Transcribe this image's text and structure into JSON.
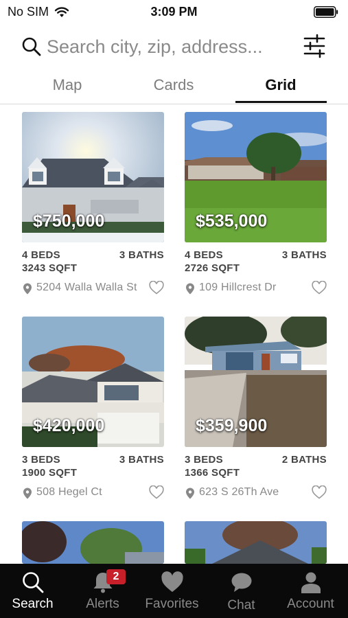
{
  "status_bar": {
    "carrier": "No SIM",
    "time": "3:09 PM"
  },
  "search": {
    "placeholder": "Search city, zip, address..."
  },
  "view_tabs": [
    {
      "label": "Map",
      "active": false
    },
    {
      "label": "Cards",
      "active": false
    },
    {
      "label": "Grid",
      "active": true
    }
  ],
  "listings": [
    {
      "price": "$750,000",
      "beds": "4 BEDS",
      "baths": "3 BATHS",
      "sqft": "3243 SQFT",
      "address": "5204 Walla Walla St"
    },
    {
      "price": "$535,000",
      "beds": "4 BEDS",
      "baths": "3 BATHS",
      "sqft": "2726 SQFT",
      "address": "109 Hillcrest Dr"
    },
    {
      "price": "$420,000",
      "beds": "3 BEDS",
      "baths": "3 BATHS",
      "sqft": "1900 SQFT",
      "address": "508 Hegel Ct"
    },
    {
      "price": "$359,900",
      "beds": "3 BEDS",
      "baths": "2 BATHS",
      "sqft": "1366 SQFT",
      "address": "623 S 26Th Ave"
    }
  ],
  "bottom_nav": [
    {
      "label": "Search",
      "icon": "search-icon",
      "active": true
    },
    {
      "label": "Alerts",
      "icon": "bell-icon",
      "badge": "2",
      "active": false
    },
    {
      "label": "Favorites",
      "icon": "heart-icon",
      "active": false
    },
    {
      "label": "Chat",
      "icon": "chat-bubble-icon",
      "active": false
    },
    {
      "label": "Account",
      "icon": "person-icon",
      "active": false
    }
  ],
  "colors": {
    "badge": "#c8202a",
    "tabbar_bg": "#0a0a0a",
    "active_label": "#ffffff",
    "inactive_label": "#8a8a8a"
  }
}
